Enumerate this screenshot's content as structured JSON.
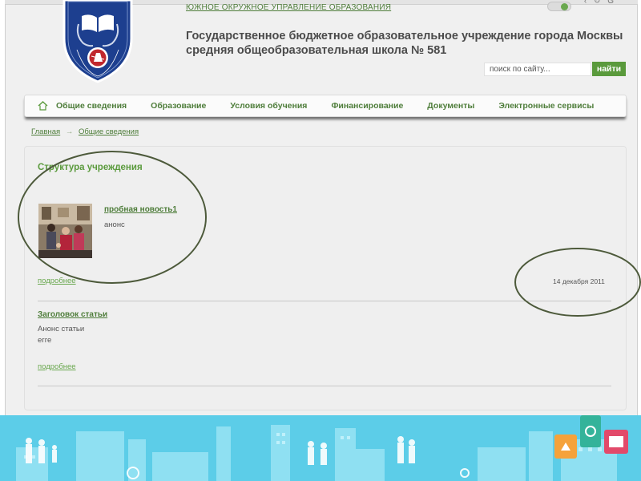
{
  "header": {
    "top_link": "ЮЖНОЕ ОКРУЖНОЕ УПРАВЛЕНИЕ ОБРАЗОВАНИЯ",
    "school_title_line1": "Государственное бюджетное образовательное учреждение города Москвы",
    "school_title_line2": "средняя общеобразовательная школа № 581",
    "search": {
      "placeholder": "поиск по сайту...",
      "button_label": "найти"
    },
    "logo": {
      "name": "school-emblem",
      "colors": {
        "shield": "#1d3f8f",
        "rim": "#ffffff"
      }
    }
  },
  "nav": {
    "home_icon": "home-icon",
    "items": [
      "Общие сведения",
      "Образование",
      "Условия обучения",
      "Финансирование",
      "Документы",
      "Электронные сервисы"
    ]
  },
  "breadcrumb": {
    "items": [
      "Главная",
      "Общие сведения"
    ],
    "separator": "→"
  },
  "main": {
    "section_title": "Структура учреждения",
    "news": {
      "title": "пробная новость1",
      "anons": "анонс",
      "more": "подробнее",
      "date": "14 декабря 2011"
    },
    "article": {
      "title": "Заголовок статьи",
      "anons": "Анонс статьи",
      "text": "егге",
      "more": "подробнее"
    }
  },
  "colors": {
    "accent_green": "#5a9a3c",
    "link_green": "#4e7d3a",
    "page_bg": "#f0f0f0",
    "footer_bg": "#5ccde8",
    "annotation_ellipse": "#4d5a3b"
  }
}
